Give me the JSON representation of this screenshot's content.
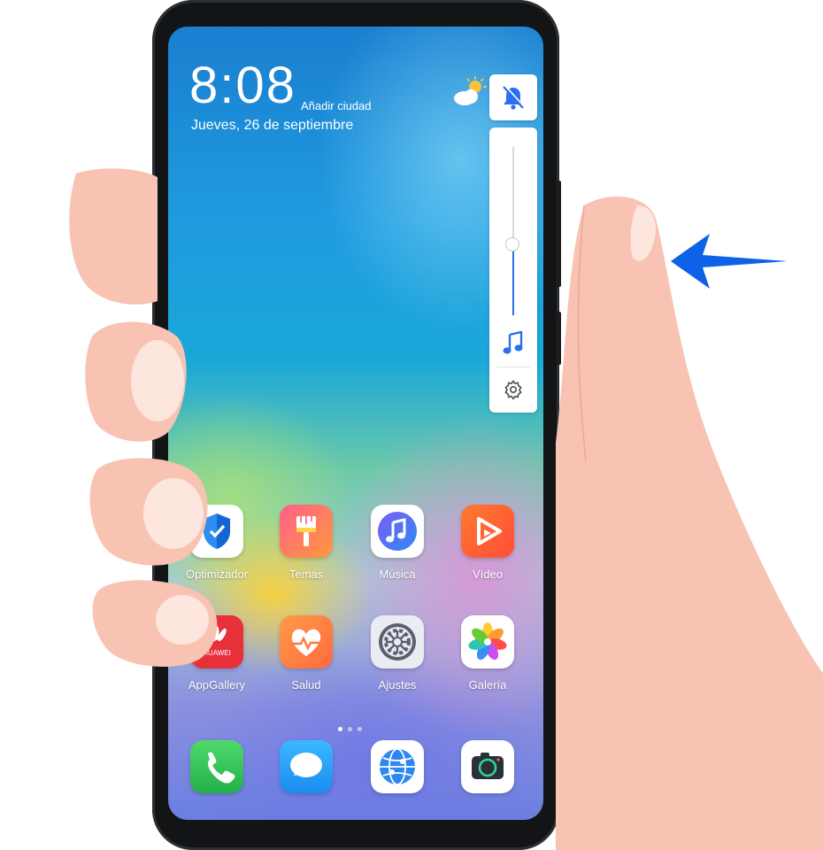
{
  "lock_screen": {
    "time": "8:08",
    "add_city": "Añadir ciudad",
    "date": "Jueves, 26 de septiembre"
  },
  "volume_panel": {
    "level": 0.42,
    "mode_icon": "bell-off-icon",
    "stream_icon": "music-note-icon",
    "settings_icon": "gear-icon"
  },
  "apps": [
    {
      "label": "Optimizador",
      "icon": "shield-icon"
    },
    {
      "label": "Temas",
      "icon": "paintbrush-icon"
    },
    {
      "label": "Música",
      "icon": "music-icon"
    },
    {
      "label": "Vídeo",
      "icon": "video-play-icon"
    },
    {
      "label": "AppGallery",
      "icon": "huawei-appgallery-icon",
      "icon_text": "HUAWEI"
    },
    {
      "label": "Salud",
      "icon": "heart-icon"
    },
    {
      "label": "Ajustes",
      "icon": "gear-icon"
    },
    {
      "label": "Galería",
      "icon": "flower-icon"
    }
  ],
  "dock": [
    {
      "name": "Teléfono",
      "icon": "phone-icon"
    },
    {
      "name": "Mensajes",
      "icon": "message-icon"
    },
    {
      "name": "Navegador",
      "icon": "globe-icon"
    },
    {
      "name": "Cámara",
      "icon": "camera-icon"
    }
  ],
  "page_indicator": {
    "count": 3,
    "active": 0
  },
  "colors": {
    "accent_blue": "#2a6ff0",
    "arrow_blue": "#0d62e8",
    "skin": "#f8c3b2"
  }
}
